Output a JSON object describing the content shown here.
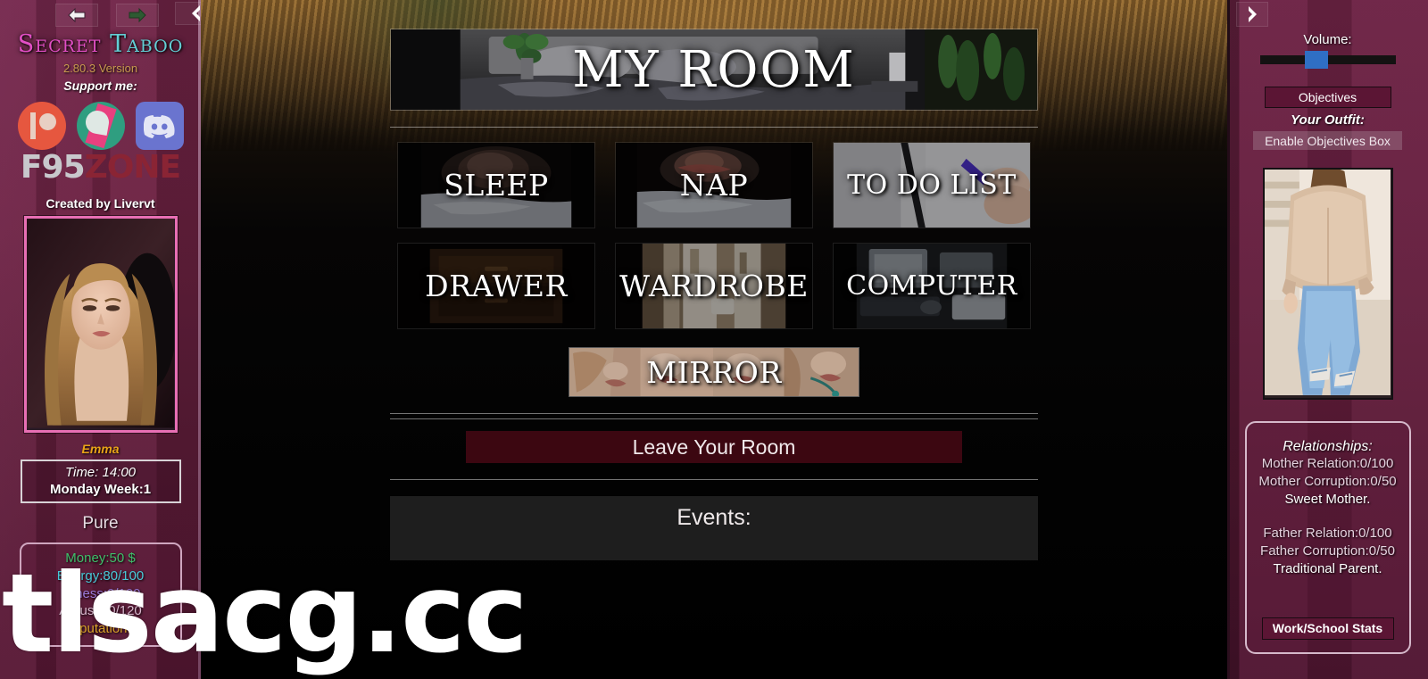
{
  "nav": {
    "back_icon": "arrow-left-icon",
    "forward_icon": "arrow-right-icon",
    "collapse_left_icon": "chevron-left-icon",
    "collapse_right_icon": "chevron-right-icon"
  },
  "sidebar_left": {
    "title_part1": "Secret",
    "title_part2": "Taboo",
    "version": "2.80.3 Version",
    "support_label": "Support me:",
    "socials": [
      {
        "name": "patreon-icon",
        "label": "Patreon"
      },
      {
        "name": "subscribestar-icon",
        "label": "SubscribeStar"
      },
      {
        "name": "discord-icon",
        "label": "Discord"
      }
    ],
    "f95_part1": "F95",
    "f95_part2": "ZONE",
    "created_by": "Created by Livervt",
    "character_name": "Emma",
    "time": "Time: 14:00",
    "day_week": "Monday Week:1",
    "purity": "Pure",
    "stats": {
      "money": "Money:50 $",
      "energy": "Energy:80/100",
      "fitness": "Fitness:0/100",
      "arousal": "Arousal:0/120",
      "reputation": "Reputation:0"
    }
  },
  "main": {
    "banner_title": "MY ROOM",
    "tiles_row1": [
      {
        "label": "SLEEP",
        "name": "tile-sleep"
      },
      {
        "label": "NAP",
        "name": "tile-nap"
      },
      {
        "label": "TO DO LIST",
        "name": "tile-to-do-list"
      }
    ],
    "tiles_row2": [
      {
        "label": "DRAWER",
        "name": "tile-drawer"
      },
      {
        "label": "WARDROBE",
        "name": "tile-wardrobe"
      },
      {
        "label": "COMPUTER",
        "name": "tile-computer"
      }
    ],
    "mirror_label": "MIRROR",
    "leave_label": "Leave Your Room",
    "events_label": "Events:"
  },
  "sidebar_right": {
    "volume_label": "Volume:",
    "volume_value": 50,
    "objectives_label": "Objectives",
    "outfit_label": "Your Outfit:",
    "enable_objectives_label": "Enable Objectives Box",
    "relationships": {
      "title": "Relationships:",
      "mother_relation": "Mother Relation:0/100",
      "mother_corruption": "Mother Corruption:0/50",
      "mother_trait": "Sweet Mother.",
      "father_relation": "Father Relation:0/100",
      "father_corruption": "Father Corruption:0/50",
      "father_trait": "Traditional Parent."
    },
    "work_school_label": "Work/School Stats"
  },
  "watermark": "tlsacg.cc",
  "colors": {
    "sidebar_bg": "#6a2140",
    "title_pink": "#e24fc5",
    "title_cyan": "#63cfd6",
    "version_gold": "#c99a4e",
    "portrait_border": "#e86fb4",
    "name_gold": "#e8a317",
    "money_green": "#3fbf6a",
    "energy_cyan": "#49c9d8",
    "fitness_purple": "#9a79d8",
    "reputation_gold": "#d8a128",
    "leave_button": "#3c0711",
    "objectives_button": "#5b1534",
    "volume_thumb": "#2f6fc4",
    "events_bg": "#1e1e1e"
  }
}
